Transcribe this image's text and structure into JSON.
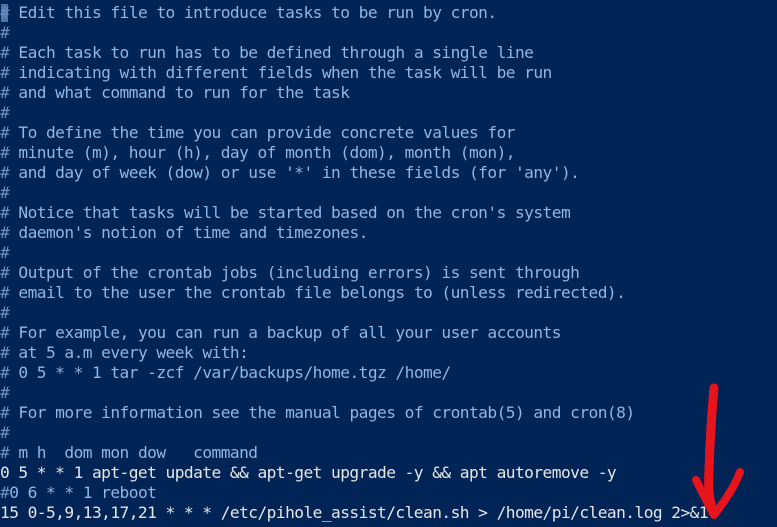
{
  "terminal": {
    "lines": [
      {
        "kind": "comment",
        "hash": "#",
        "text": " Edit this file to introduce tasks to be run by cron."
      },
      {
        "kind": "comment",
        "hash": "#",
        "text": ""
      },
      {
        "kind": "comment",
        "hash": "#",
        "text": " Each task to run has to be defined through a single line"
      },
      {
        "kind": "comment",
        "hash": "#",
        "text": " indicating with different fields when the task will be run"
      },
      {
        "kind": "comment",
        "hash": "#",
        "text": " and what command to run for the task"
      },
      {
        "kind": "comment",
        "hash": "#",
        "text": ""
      },
      {
        "kind": "comment",
        "hash": "#",
        "text": " To define the time you can provide concrete values for"
      },
      {
        "kind": "comment",
        "hash": "#",
        "text": " minute (m), hour (h), day of month (dom), month (mon),"
      },
      {
        "kind": "comment",
        "hash": "#",
        "text": " and day of week (dow) or use '*' in these fields (for 'any')."
      },
      {
        "kind": "comment",
        "hash": "#",
        "text": ""
      },
      {
        "kind": "comment",
        "hash": "#",
        "text": " Notice that tasks will be started based on the cron's system"
      },
      {
        "kind": "comment",
        "hash": "#",
        "text": " daemon's notion of time and timezones."
      },
      {
        "kind": "comment",
        "hash": "#",
        "text": ""
      },
      {
        "kind": "comment",
        "hash": "#",
        "text": " Output of the crontab jobs (including errors) is sent through"
      },
      {
        "kind": "comment",
        "hash": "#",
        "text": " email to the user the crontab file belongs to (unless redirected)."
      },
      {
        "kind": "comment",
        "hash": "#",
        "text": ""
      },
      {
        "kind": "comment",
        "hash": "#",
        "text": " For example, you can run a backup of all your user accounts"
      },
      {
        "kind": "comment",
        "hash": "#",
        "text": " at 5 a.m every week with:"
      },
      {
        "kind": "comment",
        "hash": "#",
        "text": " 0 5 * * 1 tar -zcf /var/backups/home.tgz /home/"
      },
      {
        "kind": "comment",
        "hash": "#",
        "text": ""
      },
      {
        "kind": "comment",
        "hash": "#",
        "text": " For more information see the manual pages of crontab(5) and cron(8)"
      },
      {
        "kind": "comment",
        "hash": "#",
        "text": ""
      },
      {
        "kind": "comment",
        "hash": "#",
        "text": " m h  dom mon dow   command"
      },
      {
        "kind": "command",
        "hash": "",
        "text": "0 5 * * 1 apt-get update && apt-get upgrade -y && apt autoremove -y"
      },
      {
        "kind": "comment",
        "hash": "#",
        "text": "0 6 * * 1 reboot"
      },
      {
        "kind": "command",
        "hash": "",
        "text": "15 0-5,9,13,17,21 * * * /etc/pihole_assist/clean.sh > /home/pi/clean.log 2>&1"
      }
    ]
  },
  "annotation": {
    "color": "#e8141c",
    "shape": "hand-drawn downward arrow"
  },
  "colors": {
    "background": "#012456",
    "comment_text": "#8fb6e6",
    "command_text": "#e6e6e6"
  }
}
